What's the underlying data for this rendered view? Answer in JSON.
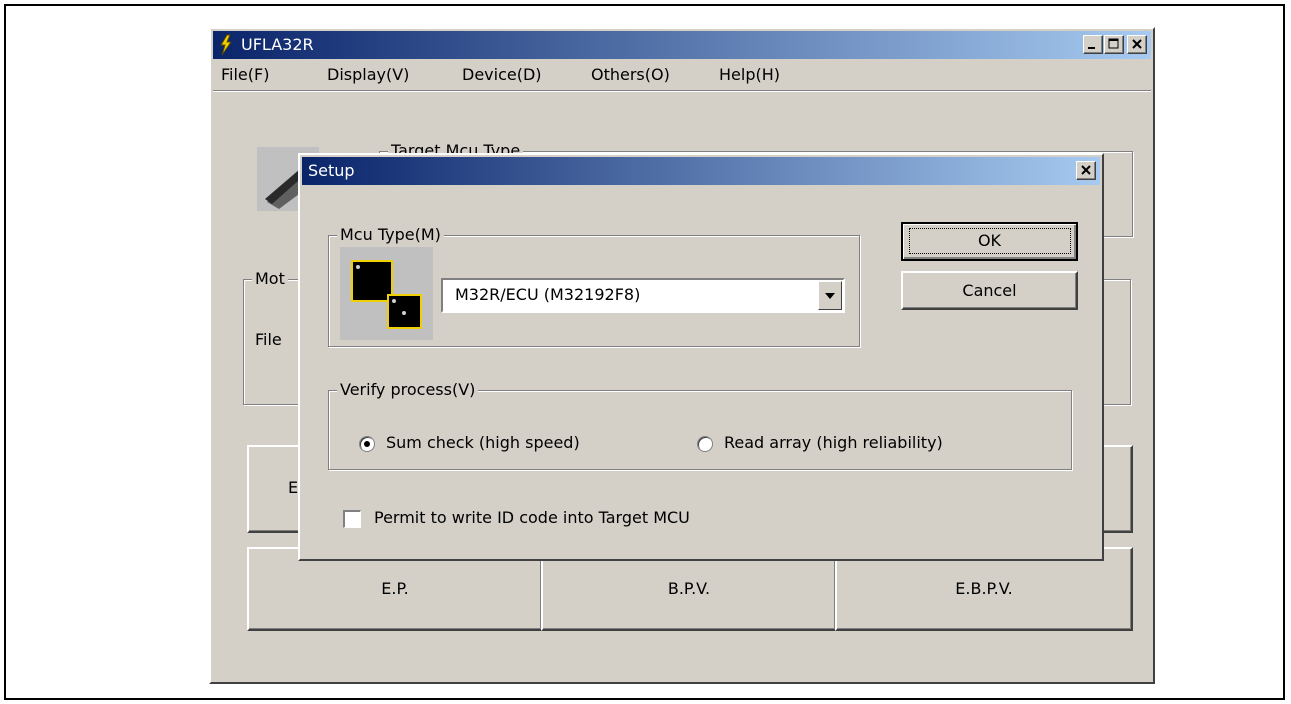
{
  "window": {
    "title": "UFLA32R",
    "menu": [
      "File(F)",
      "Display(V)",
      "Device(D)",
      "Others(O)",
      "Help(H)"
    ]
  },
  "background": {
    "target_group_label": "Target Mcu Type",
    "motorola_group_label_partial": "Mot",
    "file_label_partial": "File",
    "button_row1_partial": "E",
    "buttons": [
      "E.P.",
      "B.P.V.",
      "E.B.P.V."
    ]
  },
  "dialog": {
    "title": "Setup",
    "mcu_group_label": "Mcu Type(M)",
    "mcu_value": "M32R/ECU (M32192F8)",
    "ok_label": "OK",
    "cancel_label": "Cancel",
    "verify_group_label": "Verify process(V)",
    "radio_sum": "Sum check (high speed)",
    "radio_read": "Read array (high reliability)",
    "selected_radio": "sum",
    "permit_label": "Permit to write ID code into Target MCU",
    "permit_checked": false
  }
}
